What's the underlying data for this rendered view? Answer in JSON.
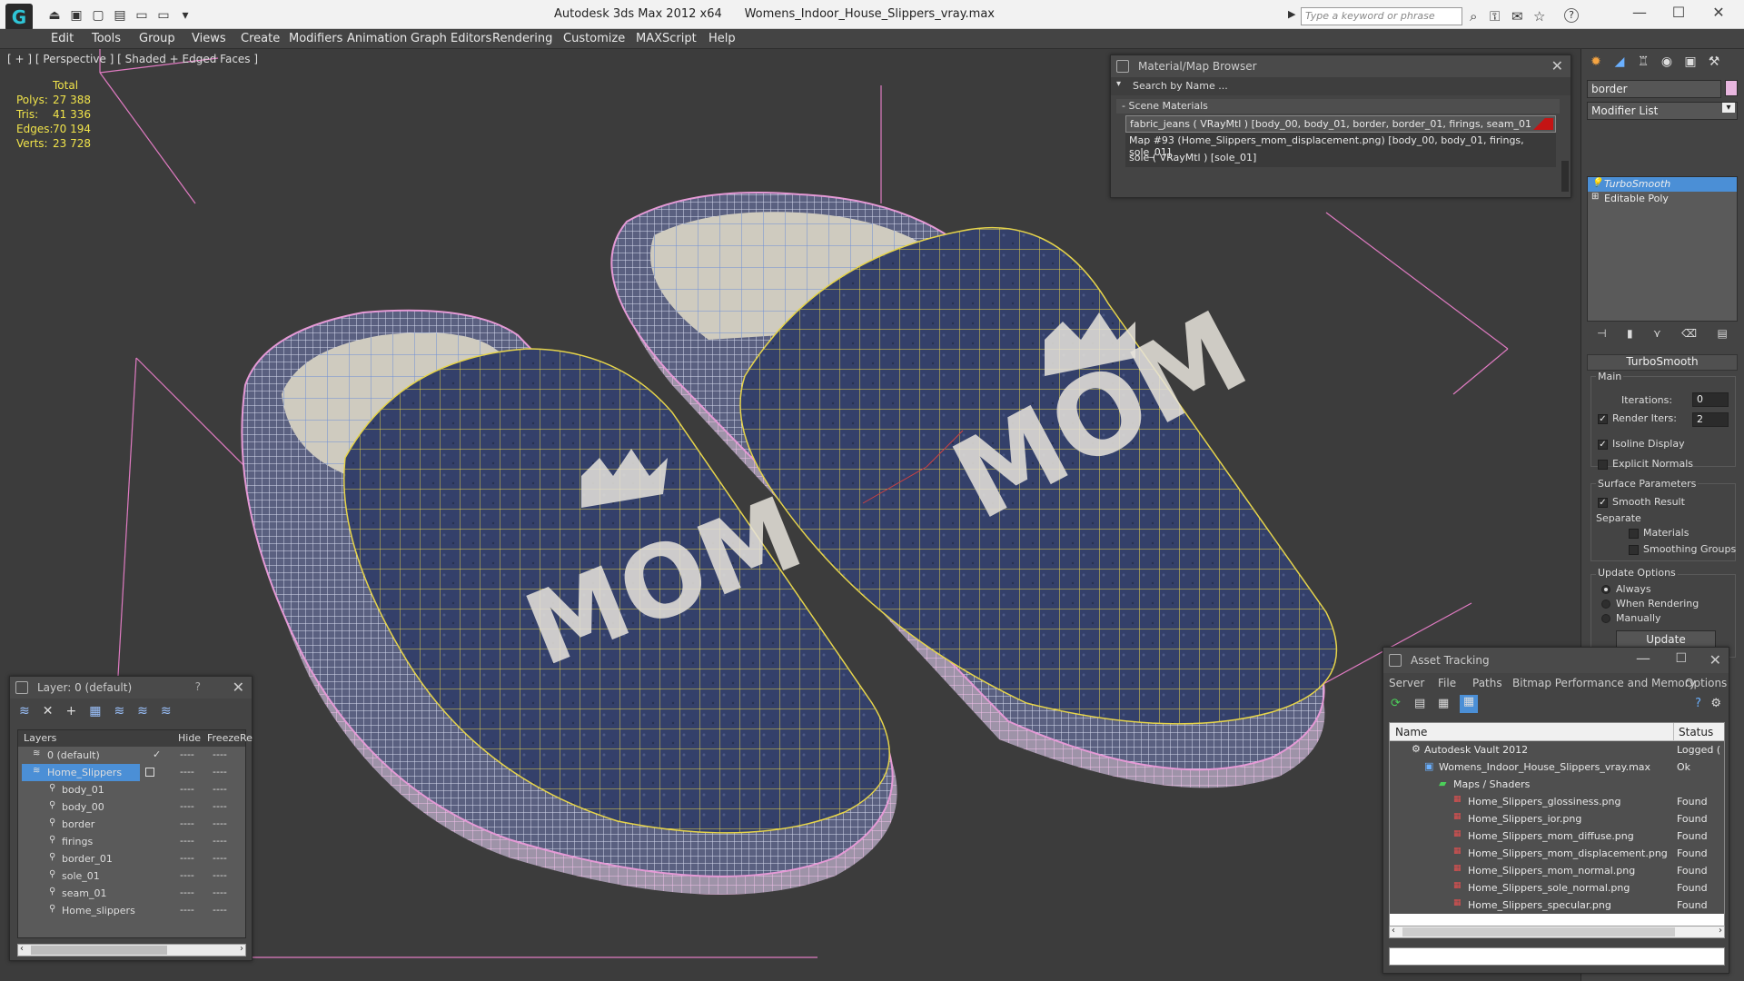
{
  "title": {
    "app": "Autodesk 3ds Max  2012 x64",
    "file": "Womens_Indoor_House_Slippers_vray.max",
    "search_placeholder": "Type a keyword or phrase",
    "help_label": "?"
  },
  "menu": [
    "Edit",
    "Tools",
    "Group",
    "Views",
    "Create",
    "Modifiers",
    "Animation",
    "Graph Editors",
    "Rendering",
    "Customize",
    "MAXScript",
    "Help"
  ],
  "viewport": {
    "label": "[ + ] [ Perspective ] [ Shaded + Edged Faces ]",
    "stats_header": "Total",
    "stats": [
      {
        "key": "Polys:",
        "value": "27 388"
      },
      {
        "key": "Tris:",
        "value": "41 336"
      },
      {
        "key": "Edges:",
        "value": "70 194"
      },
      {
        "key": "Verts:",
        "value": "23 728"
      }
    ],
    "texture_text": "MOM"
  },
  "material_browser": {
    "title": "Material/Map Browser",
    "search_placeholder": "Search by Name ...",
    "section": "- Scene Materials",
    "items": [
      "fabric_jeans  ( VRayMtl )  [body_00, body_01, border, border_01, firings, seam_01]",
      "Map #93 (Home_Slippers_mom_displacement.png) [body_00, body_01, firings, sole_01]",
      "sole  ( VRayMtl )  [sole_01]"
    ]
  },
  "command_panel": {
    "name_field": "border",
    "modifier_list": "Modifier List",
    "stack": [
      "TurboSmooth",
      "Editable Poly"
    ],
    "rollout": "TurboSmooth",
    "main": "Main",
    "iterations_label": "Iterations:",
    "iterations_value": "0",
    "render_iters_label": "Render Iters:",
    "render_iters_value": "2",
    "isoline": "Isoline Display",
    "explicit_normals": "Explicit Normals",
    "surface_params": "Surface Parameters",
    "smooth_result": "Smooth Result",
    "separate": "Separate",
    "materials": "Materials",
    "smoothing_groups": "Smoothing Groups",
    "update_options": "Update Options",
    "always": "Always",
    "when_rendering": "When Rendering",
    "manually": "Manually",
    "update_button": "Update"
  },
  "layer_panel": {
    "title": "Layer: 0 (default)",
    "help": "?",
    "columns": [
      "Layers",
      "Hide",
      "Freeze",
      "Re"
    ],
    "rows": [
      {
        "name": "0 (default)",
        "indent": 1,
        "selected": false
      },
      {
        "name": "Home_Slippers",
        "indent": 1,
        "selected": true
      },
      {
        "name": "body_01",
        "indent": 2,
        "selected": false
      },
      {
        "name": "body_00",
        "indent": 2,
        "selected": false
      },
      {
        "name": "border",
        "indent": 2,
        "selected": false
      },
      {
        "name": "firings",
        "indent": 2,
        "selected": false
      },
      {
        "name": "border_01",
        "indent": 2,
        "selected": false
      },
      {
        "name": "sole_01",
        "indent": 2,
        "selected": false
      },
      {
        "name": "seam_01",
        "indent": 2,
        "selected": false
      },
      {
        "name": "Home_slippers",
        "indent": 2,
        "selected": false
      }
    ]
  },
  "asset_tracking": {
    "title": "Asset Tracking",
    "menu": [
      "Server",
      "File",
      "Paths",
      "Bitmap Performance and Memory",
      "Options"
    ],
    "columns": [
      "Name",
      "Status"
    ],
    "rows": [
      {
        "name": "Autodesk Vault 2012",
        "status": "Logged (",
        "indent": 1
      },
      {
        "name": "Womens_Indoor_House_Slippers_vray.max",
        "status": "Ok",
        "indent": 2
      },
      {
        "name": "Maps / Shaders",
        "status": "",
        "indent": 3
      },
      {
        "name": "Home_Slippers_glossiness.png",
        "status": "Found",
        "indent": 4
      },
      {
        "name": "Home_Slippers_ior.png",
        "status": "Found",
        "indent": 4
      },
      {
        "name": "Home_Slippers_mom_diffuse.png",
        "status": "Found",
        "indent": 4
      },
      {
        "name": "Home_Slippers_mom_displacement.png",
        "status": "Found",
        "indent": 4
      },
      {
        "name": "Home_Slippers_mom_normal.png",
        "status": "Found",
        "indent": 4
      },
      {
        "name": "Home_Slippers_sole_normal.png",
        "status": "Found",
        "indent": 4
      },
      {
        "name": "Home_Slippers_specular.png",
        "status": "Found",
        "indent": 4
      }
    ]
  },
  "colors": {
    "selection": "#4b8fd6",
    "stats": "#f0e34a",
    "wire_yellow": "#e6d44a",
    "wire_pink": "#e59ad6",
    "denim": "#2f3a5c"
  }
}
